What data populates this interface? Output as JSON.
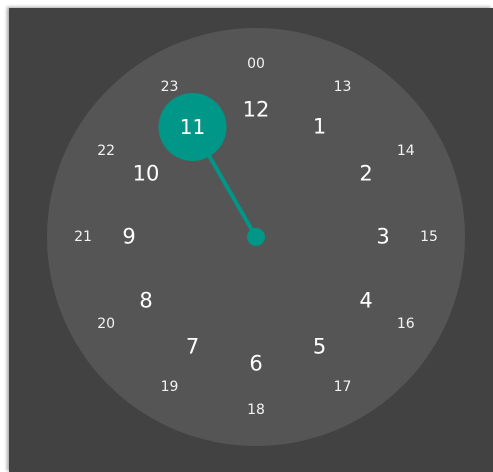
{
  "time_picker": {
    "accent_color": "#009688",
    "selected_hour": "11",
    "outer_hours": [
      "12",
      "1",
      "2",
      "3",
      "4",
      "5",
      "6",
      "7",
      "8",
      "9",
      "10",
      "11"
    ],
    "inner_hours": [
      "00",
      "13",
      "14",
      "15",
      "16",
      "17",
      "18",
      "19",
      "20",
      "21",
      "22",
      "23"
    ]
  }
}
